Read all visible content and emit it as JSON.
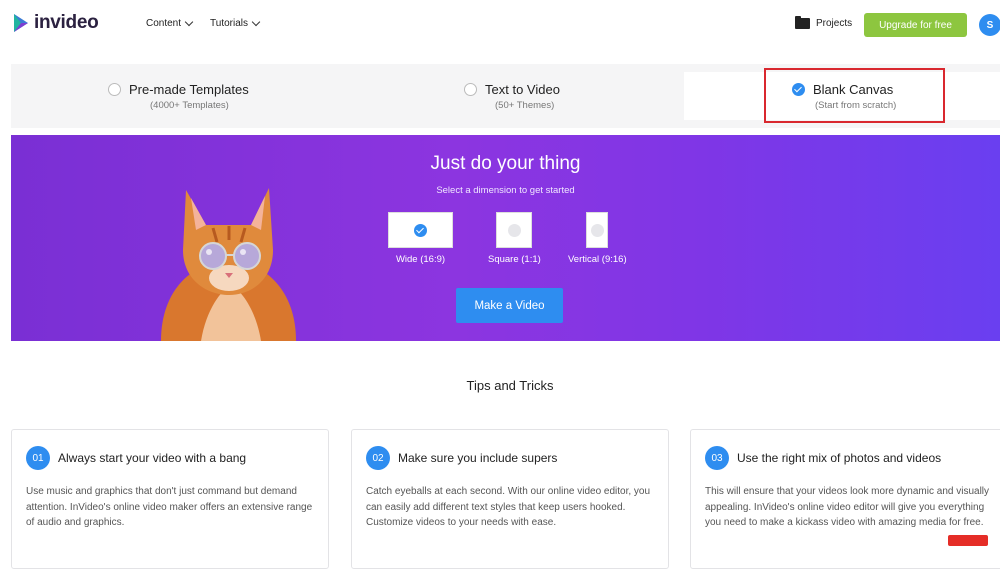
{
  "header": {
    "logo_text": "invideo",
    "menu": [
      {
        "label": "Content"
      },
      {
        "label": "Tutorials"
      }
    ],
    "projects_label": "Projects",
    "upgrade_label": "Upgrade for free",
    "avatar_initial": "S"
  },
  "modes": [
    {
      "title": "Pre-made Templates",
      "subtitle": "(4000+ Templates)",
      "selected": false
    },
    {
      "title": "Text to Video",
      "subtitle": "(50+ Themes)",
      "selected": false
    },
    {
      "title": "Blank Canvas",
      "subtitle": "(Start from scratch)",
      "selected": true
    }
  ],
  "hero": {
    "title": "Just do your thing",
    "subtitle": "Select a dimension to get started",
    "dimensions": [
      {
        "label": "Wide (16:9)",
        "selected": true
      },
      {
        "label": "Square (1:1)",
        "selected": false
      },
      {
        "label": "Vertical (9:16)",
        "selected": false
      }
    ],
    "cta_label": "Make a Video"
  },
  "tips": {
    "title": "Tips and Tricks",
    "cards": [
      {
        "number": "01",
        "title": "Always start your video with a bang",
        "body": "Use music and graphics that don't just command but demand attention. InVideo's online video maker offers an extensive range of audio and graphics."
      },
      {
        "number": "02",
        "title": "Make sure you include supers",
        "body": "Catch eyeballs at each second. With our online video editor, you can easily add different text styles that keep users hooked. Customize videos to your needs with ease."
      },
      {
        "number": "03",
        "title": "Use the right mix of photos and videos",
        "body": "This will ensure that your videos look more dynamic and visually appealing. InVideo's online video editor will give you everything you need to make a kickass video with amazing media for free."
      }
    ]
  },
  "colors": {
    "accent_blue": "#2e8df0",
    "upgrade_green": "#8dc63f",
    "hero_purple": "#8c35e0",
    "highlight_red": "#d9282f"
  },
  "icons": [
    "invideo-logo-icon",
    "chevron-down-icon",
    "folder-icon",
    "check-icon"
  ]
}
